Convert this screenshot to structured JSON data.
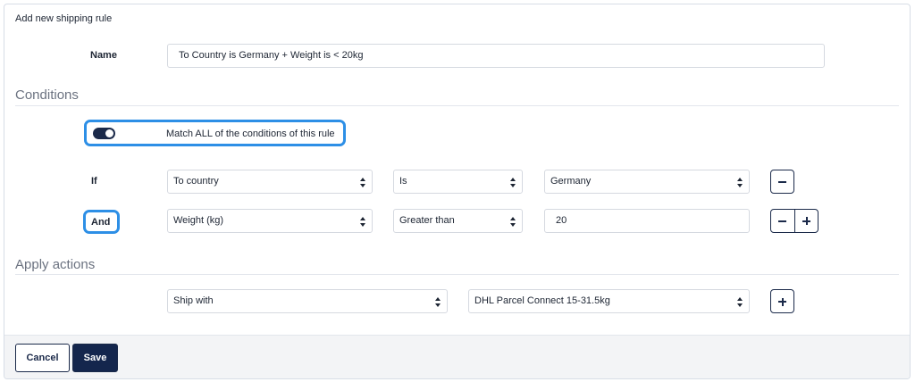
{
  "dialog": {
    "title": "Add new shipping rule"
  },
  "name_field": {
    "label": "Name",
    "value": "To Country is Germany + Weight is < 20kg"
  },
  "conditions": {
    "section_title": "Conditions",
    "match_toggle": {
      "label": "Match ALL of the conditions of this rule",
      "enabled": true
    },
    "rows": [
      {
        "connector": "If",
        "field": "To country",
        "operator": "Is",
        "value": "Germany",
        "value_type": "select"
      },
      {
        "connector": "And",
        "field": "Weight (kg)",
        "operator": "Greater than",
        "value": "20",
        "value_type": "input"
      }
    ]
  },
  "actions": {
    "section_title": "Apply actions",
    "action_select": "Ship with",
    "carrier_select": "DHL Parcel Connect 15-31.5kg"
  },
  "footer": {
    "cancel_label": "Cancel",
    "save_label": "Save"
  },
  "colors": {
    "accent_focus": "#2d8fe6",
    "primary_navy": "#14264d"
  },
  "icons": {
    "remove": "minus-icon",
    "add": "plus-icon",
    "select_arrows": "chevron-up-down-icon"
  }
}
